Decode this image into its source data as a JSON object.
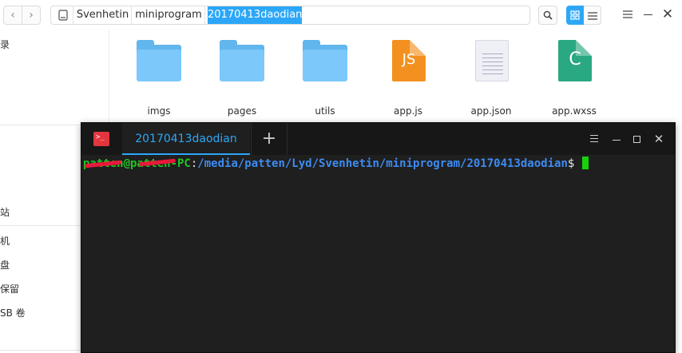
{
  "file_manager": {
    "toolbar": {
      "back_icon": "chevron-left-icon",
      "forward_icon": "chevron-right-icon",
      "back_glyph": "‹",
      "forward_glyph": "›",
      "breadcrumb": [
        "Svenhetin",
        "miniprogram",
        "20170413daodian"
      ],
      "search_icon": "search-icon",
      "view_mode": "icon",
      "close_glyph": "✕"
    },
    "sidebar": {
      "items": [
        "录",
        "站",
        "机",
        "盘",
        "保留",
        "SB 卷"
      ]
    },
    "files": [
      {
        "name": "imgs",
        "type": "folder"
      },
      {
        "name": "pages",
        "type": "folder"
      },
      {
        "name": "utils",
        "type": "folder"
      },
      {
        "name": "app.js",
        "type": "js",
        "glyph": "JS"
      },
      {
        "name": "app.json",
        "type": "json"
      },
      {
        "name": "app.wxss",
        "type": "wxss",
        "glyph": "C"
      }
    ]
  },
  "terminal": {
    "logo_glyph": ">_",
    "tab_title": "20170413daodian",
    "add_tab_glyph": "+",
    "close_glyph": "✕",
    "prompt": {
      "user_host": "patten@patten-PC",
      "separator": ":",
      "path": "/media/patten/Lyd/Svenhetin/miniprogram/20170413daodian",
      "symbol": "$"
    }
  },
  "colors": {
    "accent": "#2ca7f8",
    "terminal_bg": "#1f1f1f",
    "prompt_user": "#23c223",
    "prompt_path": "#3d8bf2",
    "cursor": "#16d20a",
    "terminal_logo": "#e2363e",
    "redaction": "#e8183a"
  }
}
